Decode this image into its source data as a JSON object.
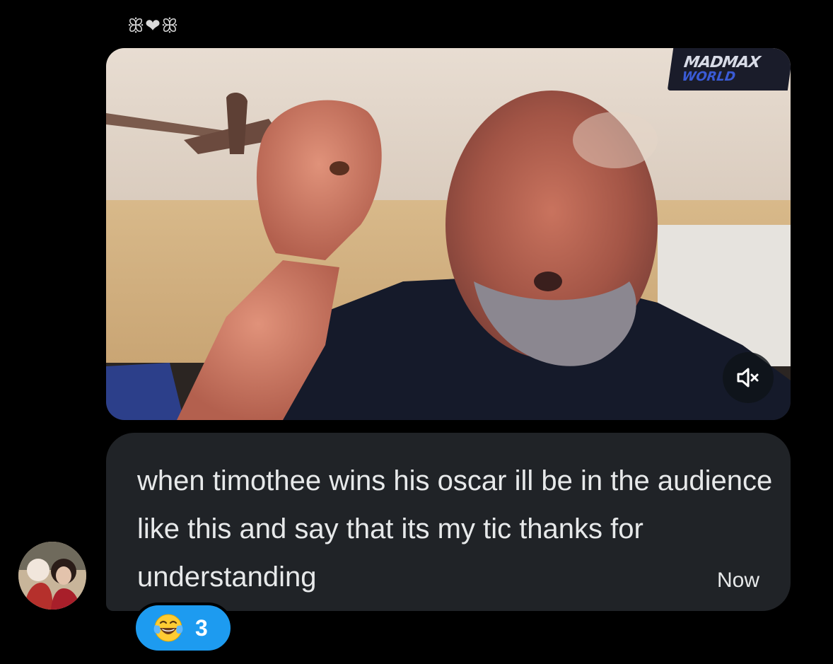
{
  "sender": {
    "display_name": "ꕥ❤ꕥ"
  },
  "media": {
    "type": "video",
    "watermark_line1": "MADMAX",
    "watermark_line2": "WORLD",
    "mute_icon": "speaker-muted-icon"
  },
  "message": {
    "text": "when timothee wins his oscar ill be in the audience like this and say that its my tic thanks for understanding",
    "timestamp": "Now"
  },
  "reaction": {
    "emoji_icon": "face-with-tears-of-joy-icon",
    "emoji": "😂",
    "count": "3"
  },
  "colors": {
    "background": "#000000",
    "bubble": "#202327",
    "reaction": "#1d9bf0",
    "text": "#e7e9ea"
  }
}
